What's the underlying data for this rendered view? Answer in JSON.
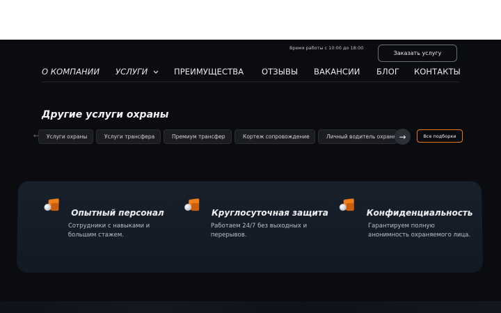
{
  "header": {
    "hours": "Время работы с 10:00 до 18:00",
    "order_button": "Заказать услугу"
  },
  "nav": {
    "items": [
      {
        "label": "О КОМПАНИИ"
      },
      {
        "label": "УСЛУГИ"
      },
      {
        "label": "ПРЕИМУЩЕСТВА"
      },
      {
        "label": "ОТЗЫВЫ"
      },
      {
        "label": "ВАКАНСИИ"
      },
      {
        "label": "БЛОГ"
      },
      {
        "label": "КОНТАКТЫ"
      }
    ]
  },
  "section": {
    "title": "Другие услуги охраны",
    "chips": [
      "Услуги охраны",
      "Услуги трансфера",
      "Премиум трансфер",
      "Кортеж сопровождение",
      "Личный водитель охранник"
    ],
    "scroll_arrow": "→",
    "left_arrow": "←",
    "all_button": "Все подборки"
  },
  "features": [
    {
      "title": "Опытный персонал",
      "desc_line1": "Сотрудники с навыками и",
      "desc_line2": "большим стажем."
    },
    {
      "title": "Круглосуточная защита",
      "desc_line1": "Работаем 24/7 без выходных и",
      "desc_line2": "перерывов."
    },
    {
      "title": "Конфиденциальность",
      "desc_line1": "Гарантируем полную",
      "desc_line2": "анонимность охраняемого лица."
    }
  ],
  "colors": {
    "accent": "#ef7d1a",
    "background": "#0b0c10",
    "card": "#151c27"
  },
  "icons": {
    "dropdown": "chevron-down-icon",
    "feature": "cube-icon"
  }
}
